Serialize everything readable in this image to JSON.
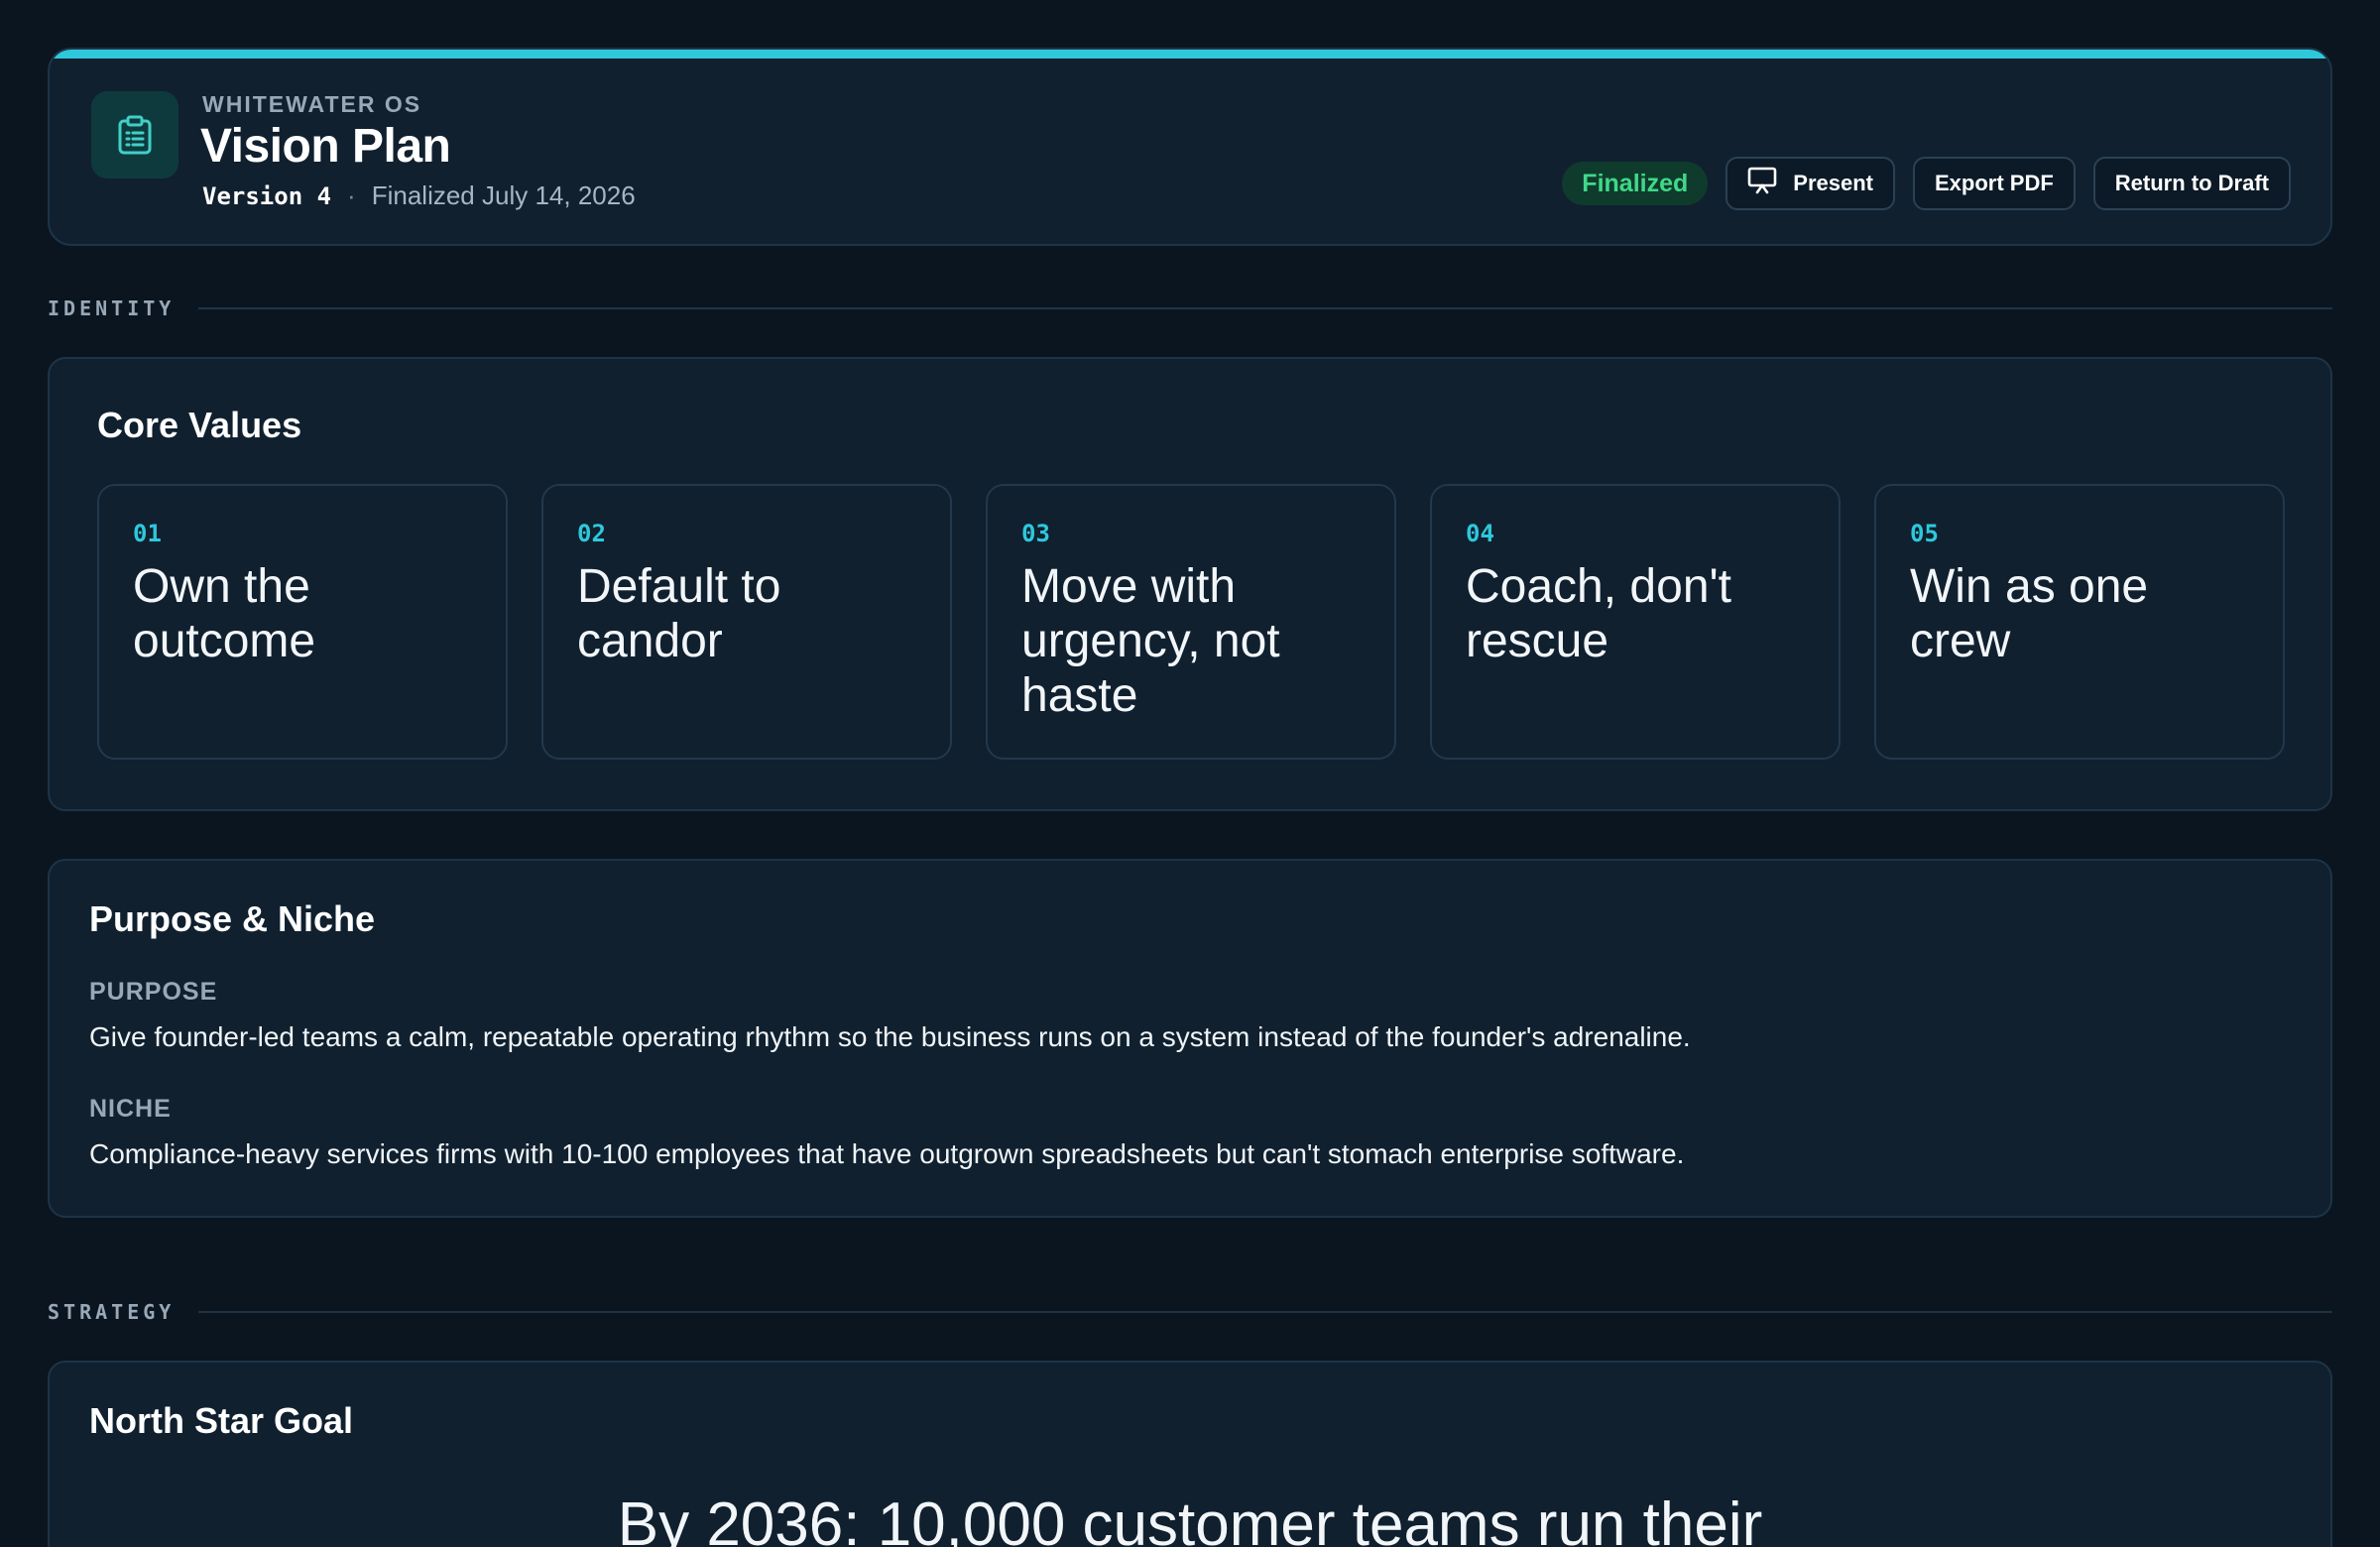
{
  "header": {
    "eyebrow": "WHITEWATER OS",
    "title": "Vision Plan",
    "version": "Version 4",
    "separator": "·",
    "finalized_date": "Finalized July 14, 2026",
    "status_badge": "Finalized",
    "actions": {
      "present": "Present",
      "export_pdf": "Export PDF",
      "return_to_draft": "Return to Draft"
    },
    "icon": "clipboard-icon",
    "accent_color": "#2ec8dc"
  },
  "sections": {
    "identity": "IDENTITY",
    "strategy": "STRATEGY"
  },
  "core_values": {
    "title": "Core Values",
    "items": [
      {
        "num": "01",
        "text": "Own the outcome"
      },
      {
        "num": "02",
        "text": "Default to candor"
      },
      {
        "num": "03",
        "text": "Move with urgency, not haste"
      },
      {
        "num": "04",
        "text": "Coach, don't rescue"
      },
      {
        "num": "05",
        "text": "Win as one crew"
      }
    ]
  },
  "purpose_niche": {
    "title": "Purpose & Niche",
    "purpose_label": "PURPOSE",
    "purpose_text": "Give founder-led teams a calm, repeatable operating rhythm so the business runs on a system instead of the founder's adrenaline.",
    "niche_label": "NICHE",
    "niche_text": "Compliance-heavy services firms with 10-100 employees that have outgrown spreadsheets but can't stomach enterprise software."
  },
  "north_star": {
    "title": "North Star Goal",
    "text": "By 2036: 10,000 customer teams run their"
  }
}
